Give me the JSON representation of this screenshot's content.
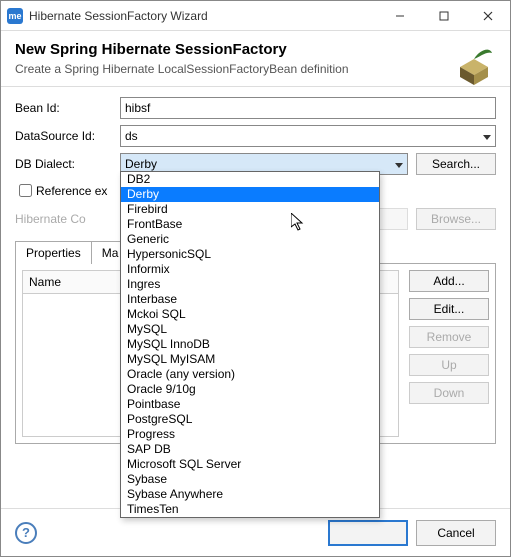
{
  "titlebar": {
    "app_icon_text": "me",
    "title": "Hibernate SessionFactory Wizard"
  },
  "header": {
    "title": "New Spring Hibernate SessionFactory",
    "subtitle": "Create a Spring Hibernate LocalSessionFactoryBean definition"
  },
  "form": {
    "bean_id": {
      "label": "Bean Id:",
      "value": "hibsf"
    },
    "datasource": {
      "label": "DataSource Id:",
      "value": "ds"
    },
    "dialect": {
      "label": "DB Dialect:",
      "value": "Derby",
      "search_label": "Search..."
    },
    "reference_existing": {
      "label": "Reference ex"
    },
    "hconfig": {
      "label": "Hibernate Co",
      "browse_label": "Browse..."
    }
  },
  "tabs": {
    "properties": "Properties",
    "mappings": "Ma"
  },
  "table": {
    "name_header": "Name"
  },
  "buttons": {
    "add": "Add...",
    "edit": "Edit...",
    "remove": "Remove",
    "up": "Up",
    "down": "Down"
  },
  "footer": {
    "help": "?",
    "finish": "",
    "cancel": "Cancel"
  },
  "dropdown": {
    "highlighted_index": 1,
    "options": [
      "DB2",
      "Derby",
      "Firebird",
      "FrontBase",
      "Generic",
      "HypersonicSQL",
      "Informix",
      "Ingres",
      "Interbase",
      "Mckoi SQL",
      "MySQL",
      "MySQL InnoDB",
      "MySQL MyISAM",
      "Oracle (any version)",
      "Oracle 9/10g",
      "Pointbase",
      "PostgreSQL",
      "Progress",
      "SAP DB",
      "Microsoft SQL Server",
      "Sybase",
      "Sybase Anywhere",
      "TimesTen"
    ]
  }
}
